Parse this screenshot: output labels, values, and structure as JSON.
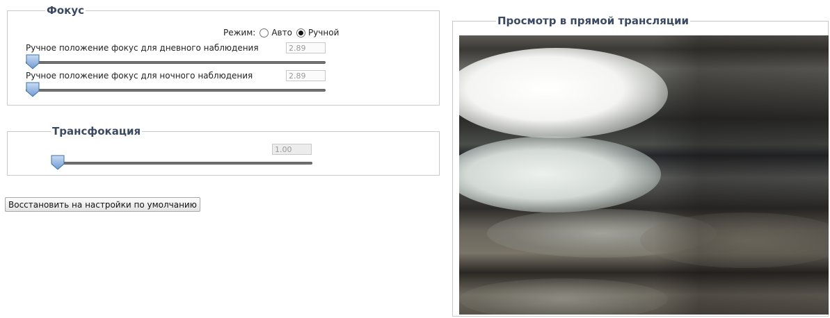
{
  "focus": {
    "legend": "Фокус",
    "mode_label": "Режим:",
    "mode_options": [
      "Авто",
      "Ручной"
    ],
    "mode_selected": "Ручной",
    "day": {
      "label": "Ручное положение фокус для дневного наблюдения",
      "value": "2.89"
    },
    "night": {
      "label": "Ручное положение фокус для ночного наблюдения",
      "value": "2.89"
    }
  },
  "zoom": {
    "legend": "Трансфокация",
    "value": "1.00"
  },
  "reset_button": "Восстановить на настройки по умолчанию",
  "preview": {
    "legend": "Просмотр в прямой трансляции"
  }
}
